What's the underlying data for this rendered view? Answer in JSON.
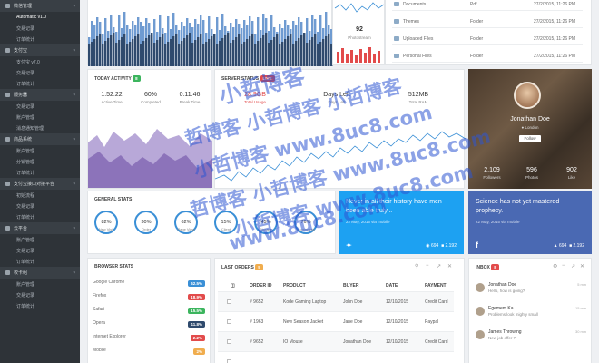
{
  "sidebar": {
    "sections": [
      {
        "title": "微信管理",
        "items": [
          "Automatic v1.0",
          "交易记录",
          "订单统计"
        ]
      },
      {
        "title": "支付宝",
        "items": [
          "支付宝 v7.0",
          "交易记录",
          "订单统计"
        ]
      },
      {
        "title": "服务器",
        "items": [
          "交易记录",
          "账户管理",
          "消息通知管理"
        ]
      },
      {
        "title": "商品系统",
        "items": [
          "账户管理",
          "分销管理",
          "订单统计"
        ]
      },
      {
        "title": "支付宝接口对接平台",
        "items": [
          "初始流程",
          "交易记录",
          "订单统计"
        ]
      },
      {
        "title": "云平台",
        "items": [
          "账户管理",
          "交易记录",
          "订单统计"
        ]
      },
      {
        "title": "校卡组",
        "items": [
          "账户管理",
          "交易记录",
          "订单统计"
        ]
      }
    ]
  },
  "photostream": {
    "count": "92",
    "label": "Photostream"
  },
  "files": [
    {
      "name": "Documents",
      "type": "Pdf",
      "date": "27/2/2015, 11:26 PM"
    },
    {
      "name": "Themes",
      "type": "Folder",
      "date": "27/2/2015, 11:26 PM"
    },
    {
      "name": "Uploaded Files",
      "type": "Folder",
      "date": "27/2/2015, 11:26 PM"
    },
    {
      "name": "Personal Files",
      "type": "Folder",
      "date": "27/2/2015, 11:26 PM"
    }
  ],
  "activity": {
    "title": "TODAY ACTIVITY",
    "badge": "8",
    "metrics": [
      {
        "value": "1:52:22",
        "label": "Active Time"
      },
      {
        "value": "60%",
        "label": "Completed"
      },
      {
        "value": "0:11:46",
        "label": "Break Time"
      }
    ]
  },
  "server": {
    "title": "SERVER STATUS",
    "badge": "LIVE",
    "metrics": [
      {
        "value": "28.9GB",
        "label": "Total Usage",
        "color": "#e24b4b"
      },
      {
        "value": "Days Left",
        "label": "Days Left",
        "color": "#333"
      },
      {
        "value": "512MB",
        "label": "Total RAM",
        "color": "#333"
      }
    ]
  },
  "profile": {
    "name": "Jonathan Doe",
    "location": "London",
    "follow_label": "Follow",
    "stats": [
      {
        "value": "2.109",
        "label": "Followers"
      },
      {
        "value": "596",
        "label": "Photos"
      },
      {
        "value": "902",
        "label": "Like"
      }
    ]
  },
  "twitter": {
    "text": "Never in all their history have men been able truly...",
    "meta": "22 May, 2015 via mobile",
    "count1": "694",
    "count2": "2.192"
  },
  "facebook": {
    "text": "Science has not yet mastered prophecy.",
    "meta": "22 May, 2015 via mobile",
    "count1": "694",
    "count2": "2.192"
  },
  "general": {
    "title": "GENERAL STATS",
    "items": [
      {
        "value": "82%",
        "label": "New Visit"
      },
      {
        "value": "30%",
        "label": "Order"
      },
      {
        "value": "62%",
        "label": "Page View"
      },
      {
        "value": "15%",
        "label": "Client"
      },
      {
        "value": "45%",
        "label": "Storage"
      },
      {
        "value": "76%",
        "label": "Comments"
      }
    ]
  },
  "browser": {
    "title": "BROWSER STATS",
    "rows": [
      {
        "name": "Google Chrome",
        "pct": "62.5%",
        "color": "#3a8fd6"
      },
      {
        "name": "Firefox",
        "pct": "18.9%",
        "color": "#e24b4b"
      },
      {
        "name": "Safari",
        "pct": "15.5%",
        "color": "#3cb55e"
      },
      {
        "name": "Opera",
        "pct": "11.8%",
        "color": "#2f4a6d"
      },
      {
        "name": "Internet Explorer",
        "pct": "2.2%",
        "color": "#e24b4b"
      },
      {
        "name": "Mobile",
        "pct": "2%",
        "color": "#f0ad4e"
      }
    ]
  },
  "orders": {
    "title": "LAST ORDERS",
    "badge": "5",
    "headers": [
      "ORDER ID",
      "PRODUCT",
      "BUYER",
      "DATE",
      "PAYMENT"
    ],
    "rows": [
      {
        "id": "# 9652",
        "product": "Kode Gaming Laptop",
        "buyer": "John Doe",
        "date": "12/10/2015",
        "payment": "Credit Card"
      },
      {
        "id": "# 1963",
        "product": "New Season Jacket",
        "buyer": "Jane Doe",
        "date": "12/10/2015",
        "payment": "Paypal"
      },
      {
        "id": "# 9652",
        "product": "IO Mouse",
        "buyer": "Jonathan Doe",
        "date": "12/10/2015",
        "payment": "Credit Card"
      },
      {
        "id": "",
        "product": "",
        "buyer": "",
        "date": "",
        "payment": ""
      }
    ]
  },
  "inbox": {
    "title": "INBOX",
    "badge": "8",
    "messages": [
      {
        "name": "Jonathan Doe",
        "msg": "Hello, how is going?",
        "time": "5 min"
      },
      {
        "name": "Egemem Ka",
        "msg": "Problems look mighty small",
        "time": "15 min"
      },
      {
        "name": "James Throwing",
        "msg": "New job offer ?",
        "time": "30 min"
      }
    ]
  },
  "watermark": {
    "lines": [
      "小哲博客",
      "哲博客 小哲博客 小哲博客",
      "小哲博客 www.8uc8.com",
      "哲博客 小哲博客 www.8uc8.com",
      "小哲博客 www.8uc8.com",
      "www.8uc8.com"
    ]
  },
  "colors": {
    "accent": "#3a8fd6",
    "sidebar": "#2e3338",
    "twitter": "#1da1f2",
    "facebook": "#4a69b3",
    "purple": "#9b86c4"
  }
}
